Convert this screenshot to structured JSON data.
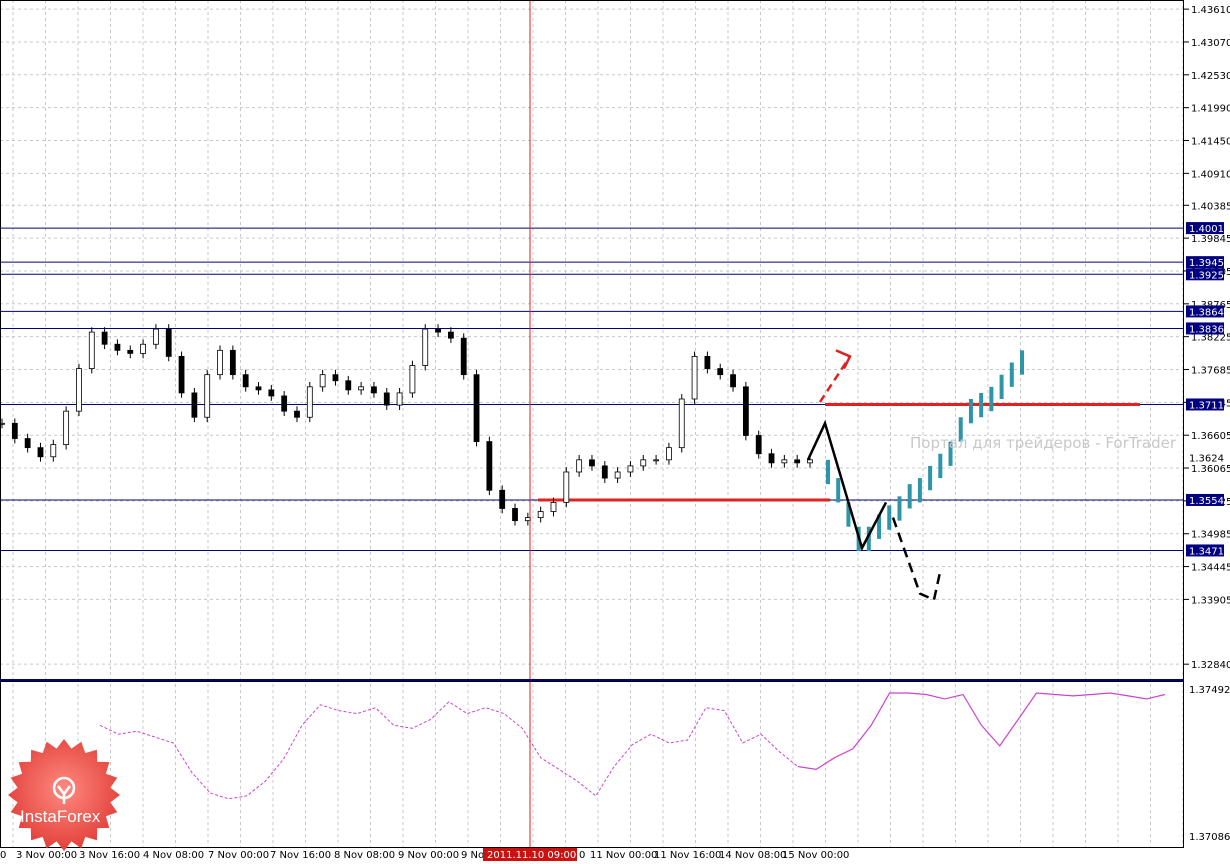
{
  "chart_data": [
    {
      "type": "line",
      "title": "",
      "ylim": [
        1.3258,
        1.4376
      ],
      "price_ticks": [
        1.4361,
        1.4307,
        1.4253,
        1.4199,
        1.4145,
        1.4091,
        1.40385,
        1.39845,
        1.39305,
        1.38765,
        1.38225,
        1.37685,
        1.37145,
        1.36605,
        1.36065,
        1.35525,
        1.34985,
        1.34445,
        1.33905,
        1.3284
      ],
      "levels": [
        {
          "value": 1.4001,
          "label": "1.4001"
        },
        {
          "value": 1.3945,
          "label": "1.3945"
        },
        {
          "value": 1.3925,
          "label": "1.3925"
        },
        {
          "value": 1.3864,
          "label": "1.3864"
        },
        {
          "value": 1.3836,
          "label": "1.3836"
        },
        {
          "value": 1.3711,
          "label": "1.3711"
        },
        {
          "value": 1.3554,
          "label": "1.3554"
        },
        {
          "value": 1.3471,
          "label": "1.3471"
        }
      ],
      "current_price_label": "1.3624",
      "red_levels": [
        {
          "value": 1.3554,
          "from": "2011.11.10 09:00",
          "to": "15 Nov 00:00"
        },
        {
          "value": 1.3711,
          "from": "15 Nov 00:00",
          "to": "future"
        }
      ],
      "time_labels": [
        "0",
        "3 Nov 00:00",
        "3 Nov 16:00",
        "4 Nov 08:00",
        "7 Nov 00:00",
        "7 Nov 16:00",
        "8 Nov 08:00",
        "9 Nov 00:00",
        "9 Nov",
        "0",
        "11 Nov 00:00",
        "11 Nov 16:00",
        "14 Nov 08:00",
        "15 Nov 00:00"
      ],
      "crosshair_time": "2011.11.10 09:00",
      "series": [
        {
          "values": [
            1.368,
            1.3655,
            1.364,
            1.3625,
            1.3645,
            1.37,
            1.377,
            1.383,
            1.381,
            1.38,
            1.3795,
            1.381,
            1.3835,
            1.379,
            1.373,
            1.369,
            1.376,
            1.38,
            1.376,
            1.374,
            1.3735,
            1.3725,
            1.37,
            1.369,
            1.374,
            1.376,
            1.375,
            1.3735,
            1.374,
            1.373,
            1.371,
            1.373,
            1.3775,
            1.3835,
            1.383,
            1.382,
            1.376,
            1.365,
            1.357,
            1.354,
            1.352,
            1.3525,
            1.3535,
            1.355,
            1.36,
            1.362,
            1.361,
            1.359,
            1.36,
            1.361,
            1.362,
            1.362,
            1.364,
            1.372,
            1.379,
            1.377,
            1.376,
            1.374,
            1.366,
            1.363,
            1.3615,
            1.362,
            1.3615,
            1.362
          ]
        }
      ],
      "forecast_bars": [
        1.36,
        1.357,
        1.353,
        1.349,
        1.349,
        1.351,
        1.3525,
        1.354,
        1.356,
        1.357,
        1.359,
        1.361,
        1.363,
        1.367,
        1.37,
        1.371,
        1.372,
        1.374,
        1.376,
        1.378
      ],
      "annotations": [
        "Портал для трейдеров - ForTrader"
      ]
    },
    {
      "type": "line",
      "ylim": [
        1.37086,
        1.37492
      ],
      "ticks": [
        1.37492,
        1.37086
      ],
      "series": [
        {
          "values": [
            0.78,
            0.72,
            0.74,
            0.7,
            0.66,
            0.46,
            0.32,
            0.28,
            0.3,
            0.4,
            0.55,
            0.78,
            0.92,
            0.88,
            0.86,
            0.9,
            0.78,
            0.76,
            0.82,
            0.94,
            0.86,
            0.9,
            0.86,
            0.76,
            0.56,
            0.48,
            0.4,
            0.3,
            0.5,
            0.65,
            0.72,
            0.66,
            0.68,
            0.9,
            0.88,
            0.66,
            0.72,
            0.6,
            0.5,
            0.48,
            0.56,
            0.62,
            0.78,
            1.0,
            1.0,
            0.99,
            0.96,
            0.99,
            0.78,
            0.64,
            0.82,
            1.0,
            0.99,
            0.98,
            0.99,
            1.0,
            0.98,
            0.96,
            0.99
          ]
        }
      ]
    }
  ],
  "colors": {
    "level_line": "#00007a",
    "label_bg": "#000080",
    "red": "#dd2222",
    "forecast": "#2e95a8",
    "osc": "#cc44cc",
    "grid": "#c8c8c8"
  },
  "logo": {
    "text": "InstaForex"
  }
}
